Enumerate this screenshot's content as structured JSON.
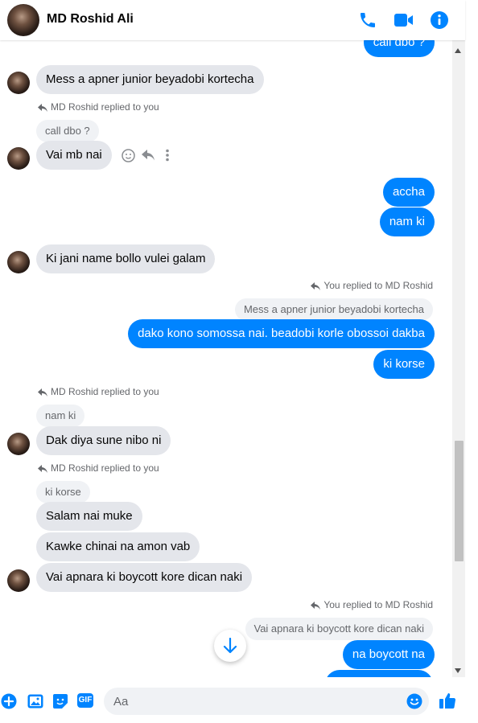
{
  "header": {
    "name": "MD Roshid Ali"
  },
  "messages": {
    "top_partial": "call dbo ?",
    "m1": "Mess a apner junior beyadobi kortecha",
    "r1_note": "MD Roshid replied to you",
    "r1_quote": "call dbo ?",
    "m2": "Vai mb nai",
    "o1": "accha",
    "o2": "nam ki",
    "m3": "Ki jani name bollo vulei galam",
    "r2_note": "You replied to MD Roshid",
    "r2_quote": "Mess a apner junior beyadobi kortecha",
    "o3": "dako kono somossa nai. beadobi korle obossoi dakba",
    "o4": "ki korse",
    "r3_note": "MD Roshid replied to you",
    "r3_quote": "nam ki",
    "m4": "Dak diya sune nibo ni",
    "r4_note": "MD Roshid replied to you",
    "r4_quote": "ki korse",
    "m5": "Salam nai muke",
    "m6": "Kawke chinai na amon vab",
    "m7": "Vai apnara ki boycott kore dican naki",
    "r5_note": "You replied to MD Roshid",
    "r5_quote": "Vai apnara ki boycott kore dican naki",
    "o5": "na boycott na"
  },
  "composer": {
    "placeholder": "Aa",
    "gif_label": "GIF"
  },
  "icons": [
    "phone-icon",
    "video-icon",
    "info-icon",
    "smile-reaction-icon",
    "reply-icon",
    "more-icon",
    "scroll-down-icon",
    "plus-icon",
    "image-icon",
    "sticker-icon",
    "gif-icon",
    "emoji-icon",
    "like-icon"
  ],
  "colors": {
    "accent": "#0084ff",
    "incoming": "#e4e6eb",
    "quote": "#f0f2f5"
  }
}
